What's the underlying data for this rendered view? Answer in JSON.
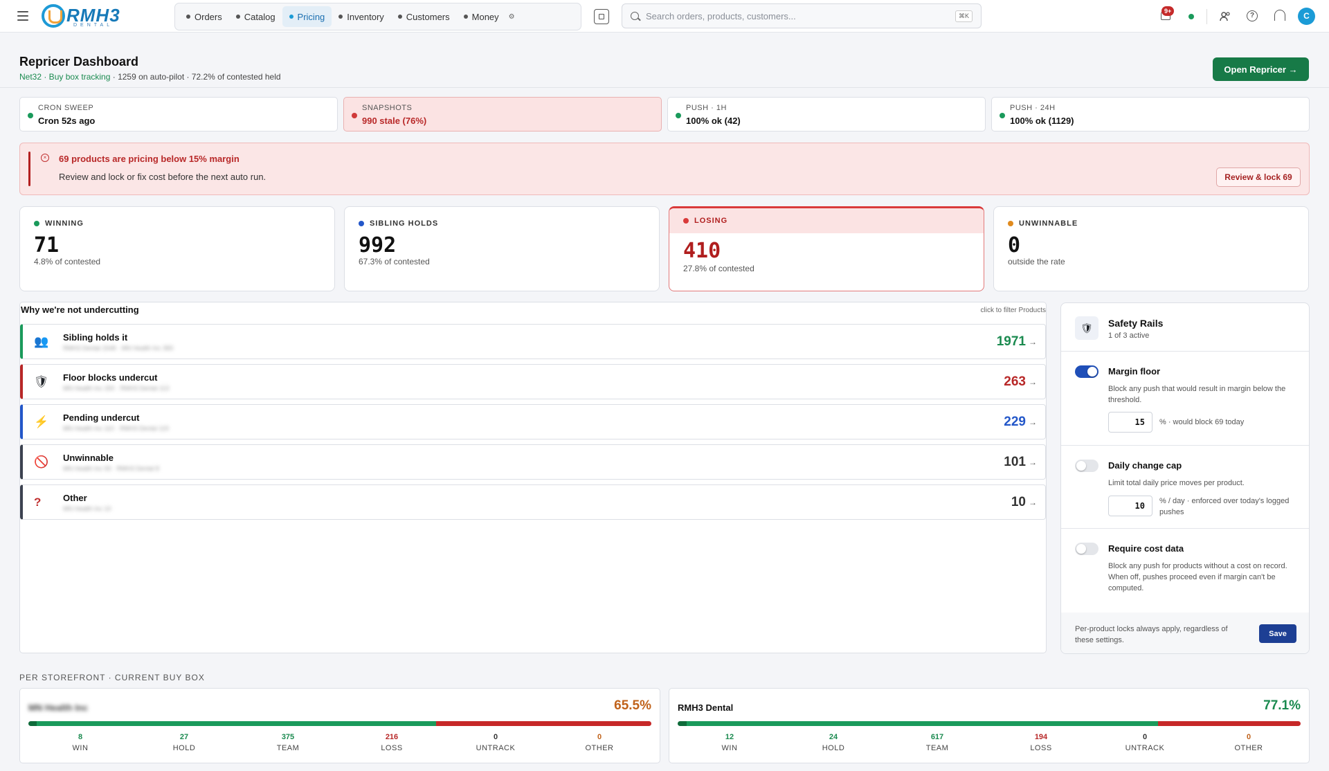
{
  "app": {
    "logo_text": "RMH3",
    "logo_sub": "DENTAL"
  },
  "nav": [
    {
      "label": "Orders",
      "active": false
    },
    {
      "label": "Catalog",
      "active": false
    },
    {
      "label": "Pricing",
      "active": true
    },
    {
      "label": "Inventory",
      "active": false
    },
    {
      "label": "Customers",
      "active": false
    },
    {
      "label": "Money",
      "active": false
    }
  ],
  "search": {
    "placeholder": "Search orders, products, customers...",
    "shortcut": "⌘K"
  },
  "topbar": {
    "notif_badge": "9+",
    "avatar_initial": "C"
  },
  "page": {
    "title": "Repricer Dashboard",
    "subtitle_link": "Net32 · Buy box tracking",
    "subtitle_rest": " · 1259 on auto-pilot · 72.2% of contested held",
    "open_button": "Open Repricer →"
  },
  "status_cards": [
    {
      "label": "CRON SWEEP",
      "value": "Cron 52s ago",
      "state": "ok"
    },
    {
      "label": "SNAPSHOTS",
      "value": "990 stale (76%)",
      "state": "bad"
    },
    {
      "label": "PUSH · 1H",
      "value": "100% ok (42)",
      "state": "ok"
    },
    {
      "label": "PUSH · 24H",
      "value": "100% ok (1129)",
      "state": "ok"
    }
  ],
  "alert": {
    "title": "69 products are pricing below 15% margin",
    "detail": "Review and lock or fix cost before the next auto run.",
    "button": "Review & lock 69"
  },
  "kpis": [
    {
      "label": "WINNING",
      "value": "71",
      "sub": "4.8% of contested",
      "color": "#1a9a5b"
    },
    {
      "label": "SIBLING HOLDS",
      "value": "992",
      "sub": "67.3% of contested",
      "color": "#2357c9"
    },
    {
      "label": "LOSING",
      "value": "410",
      "sub": "27.8% of contested",
      "color": "#d93a3a"
    },
    {
      "label": "UNWINNABLE",
      "value": "0",
      "sub": "outside the rate",
      "color": "#e08a1e"
    }
  ],
  "why": {
    "title": "Why we're not undercutting",
    "hint": "click to filter Products",
    "rows": [
      {
        "icon": "👥",
        "icon_name": "people-icon",
        "title": "Sibling holds it",
        "blurred": "RMH3 Dental 1548 · MN Health Inc 383",
        "count": "1971",
        "color": "#1a8a4f"
      },
      {
        "icon": "🛡",
        "icon_name": "shield-icon",
        "title": "Floor blocks undercut",
        "blurred": "MN Health Inc 150 · RMH3 Dental 113",
        "count": "263",
        "color": "#b82828"
      },
      {
        "icon": "⚡",
        "icon_name": "lightning-icon",
        "title": "Pending undercut",
        "blurred": "MN Health Inc 110 · RMH3 Dental 119",
        "count": "229",
        "color": "#2357c9"
      },
      {
        "icon": "🚫",
        "icon_name": "prohibited-icon",
        "title": "Unwinnable",
        "blurred": "MN Health Inc 93 · RMH3 Dental 8",
        "count": "101",
        "color": "#333"
      },
      {
        "icon": "?",
        "icon_name": "question-icon",
        "title": "Other",
        "blurred": "MN Health Inc 10",
        "count": "10",
        "color": "#333"
      }
    ]
  },
  "rails": {
    "title": "Safety Rails",
    "subtitle": "1 of 3 active",
    "items": [
      {
        "title": "Margin floor",
        "on": true,
        "desc": "Block any push that would result in margin below the threshold.",
        "value": "15",
        "note": "% · would block 69 today"
      },
      {
        "title": "Daily change cap",
        "on": false,
        "desc": "Limit total daily price moves per product.",
        "value": "10",
        "note": "% / day · enforced over today's logged pushes"
      },
      {
        "title": "Require cost data",
        "on": false,
        "desc": "Block any push for products without a cost on record. When off, pushes proceed even if margin can't be computed."
      }
    ],
    "footer_note": "Per-product locks always apply, regardless of these settings.",
    "save": "Save"
  },
  "storefronts": {
    "label": "PER STOREFRONT · CURRENT BUY BOX",
    "stores": [
      {
        "name": "MN Health Inc",
        "blurred": true,
        "percent": "65.5%",
        "pct_color": "#c0621a",
        "cols": [
          {
            "label": "WIN",
            "value": "8",
            "color": "#1a8a4f"
          },
          {
            "label": "HOLD",
            "value": "27",
            "color": "#1a8a4f"
          },
          {
            "label": "TEAM",
            "value": "375",
            "color": "#1a8a4f"
          },
          {
            "label": "LOSS",
            "value": "216",
            "color": "#b82828"
          },
          {
            "label": "UNTRACK",
            "value": "0",
            "color": "#333"
          },
          {
            "label": "OTHER",
            "value": "0",
            "color": "#c0621a"
          }
        ]
      },
      {
        "name": "RMH3 Dental",
        "blurred": false,
        "percent": "77.1%",
        "pct_color": "#1a8a4f",
        "cols": [
          {
            "label": "WIN",
            "value": "12",
            "color": "#1a8a4f"
          },
          {
            "label": "HOLD",
            "value": "24",
            "color": "#1a8a4f"
          },
          {
            "label": "TEAM",
            "value": "617",
            "color": "#1a8a4f"
          },
          {
            "label": "LOSS",
            "value": "194",
            "color": "#b82828"
          },
          {
            "label": "UNTRACK",
            "value": "0",
            "color": "#333"
          },
          {
            "label": "OTHER",
            "value": "0",
            "color": "#c0621a"
          }
        ]
      }
    ]
  }
}
